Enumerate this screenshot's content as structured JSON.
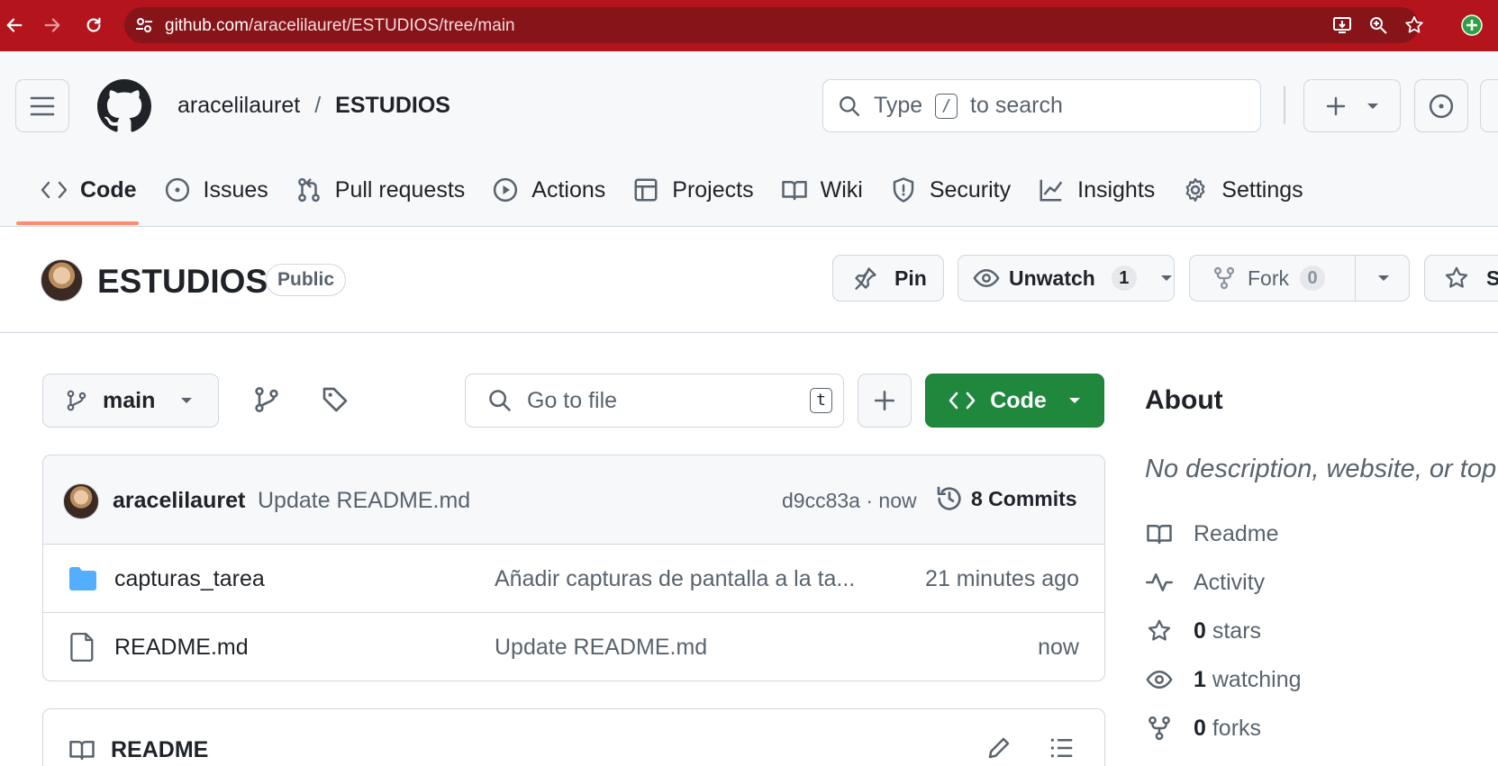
{
  "browser": {
    "url_host": "github.com",
    "url_path": "/aracelilauret/ESTUDIOS/tree/main",
    "chrome_color": "#b4141b"
  },
  "header": {
    "owner": "aracelilauret",
    "separator": "/",
    "repo": "ESTUDIOS",
    "search": {
      "prefix": "Type",
      "key": "/",
      "suffix": "to search"
    }
  },
  "tabs": [
    {
      "label": "Code",
      "icon": "code-icon"
    },
    {
      "label": "Issues",
      "icon": "issue-icon"
    },
    {
      "label": "Pull requests",
      "icon": "pull-request-icon"
    },
    {
      "label": "Actions",
      "icon": "play-icon"
    },
    {
      "label": "Projects",
      "icon": "table-icon"
    },
    {
      "label": "Wiki",
      "icon": "book-icon"
    },
    {
      "label": "Security",
      "icon": "shield-icon"
    },
    {
      "label": "Insights",
      "icon": "graph-icon"
    },
    {
      "label": "Settings",
      "icon": "gear-icon"
    }
  ],
  "repo": {
    "name": "ESTUDIOS",
    "visibility": "Public",
    "pin_label": "Pin",
    "unwatch_label": "Unwatch",
    "watch_count": "1",
    "fork_label": "Fork",
    "fork_count": "0",
    "star_label_partial": "S"
  },
  "toolbar": {
    "branch": "main",
    "goto_placeholder": "Go to file",
    "goto_key": "t",
    "code_label": "Code"
  },
  "commit": {
    "author": "aracelilauret",
    "message": "Update README.md",
    "hash_time": "d9cc83a · now",
    "commits_count": "8 Commits"
  },
  "files": [
    {
      "type": "folder",
      "name": "capturas_tarea",
      "message": "Añadir capturas de pantalla a la ta...",
      "time": "21 minutes ago"
    },
    {
      "type": "file",
      "name": "README.md",
      "message": "Update README.md",
      "time": "now"
    }
  ],
  "readme": {
    "title": "README"
  },
  "about": {
    "title": "About",
    "description": "No description, website, or top",
    "readme": "Readme",
    "activity": "Activity",
    "stars_count": "0",
    "stars_label": "stars",
    "watching_count": "1",
    "watching_label": "watching",
    "forks_count": "0",
    "forks_label": "forks"
  },
  "colors": {
    "accent_green": "#1f883d",
    "tab_underline": "#fd8c73",
    "folder_blue": "#54aeff"
  }
}
